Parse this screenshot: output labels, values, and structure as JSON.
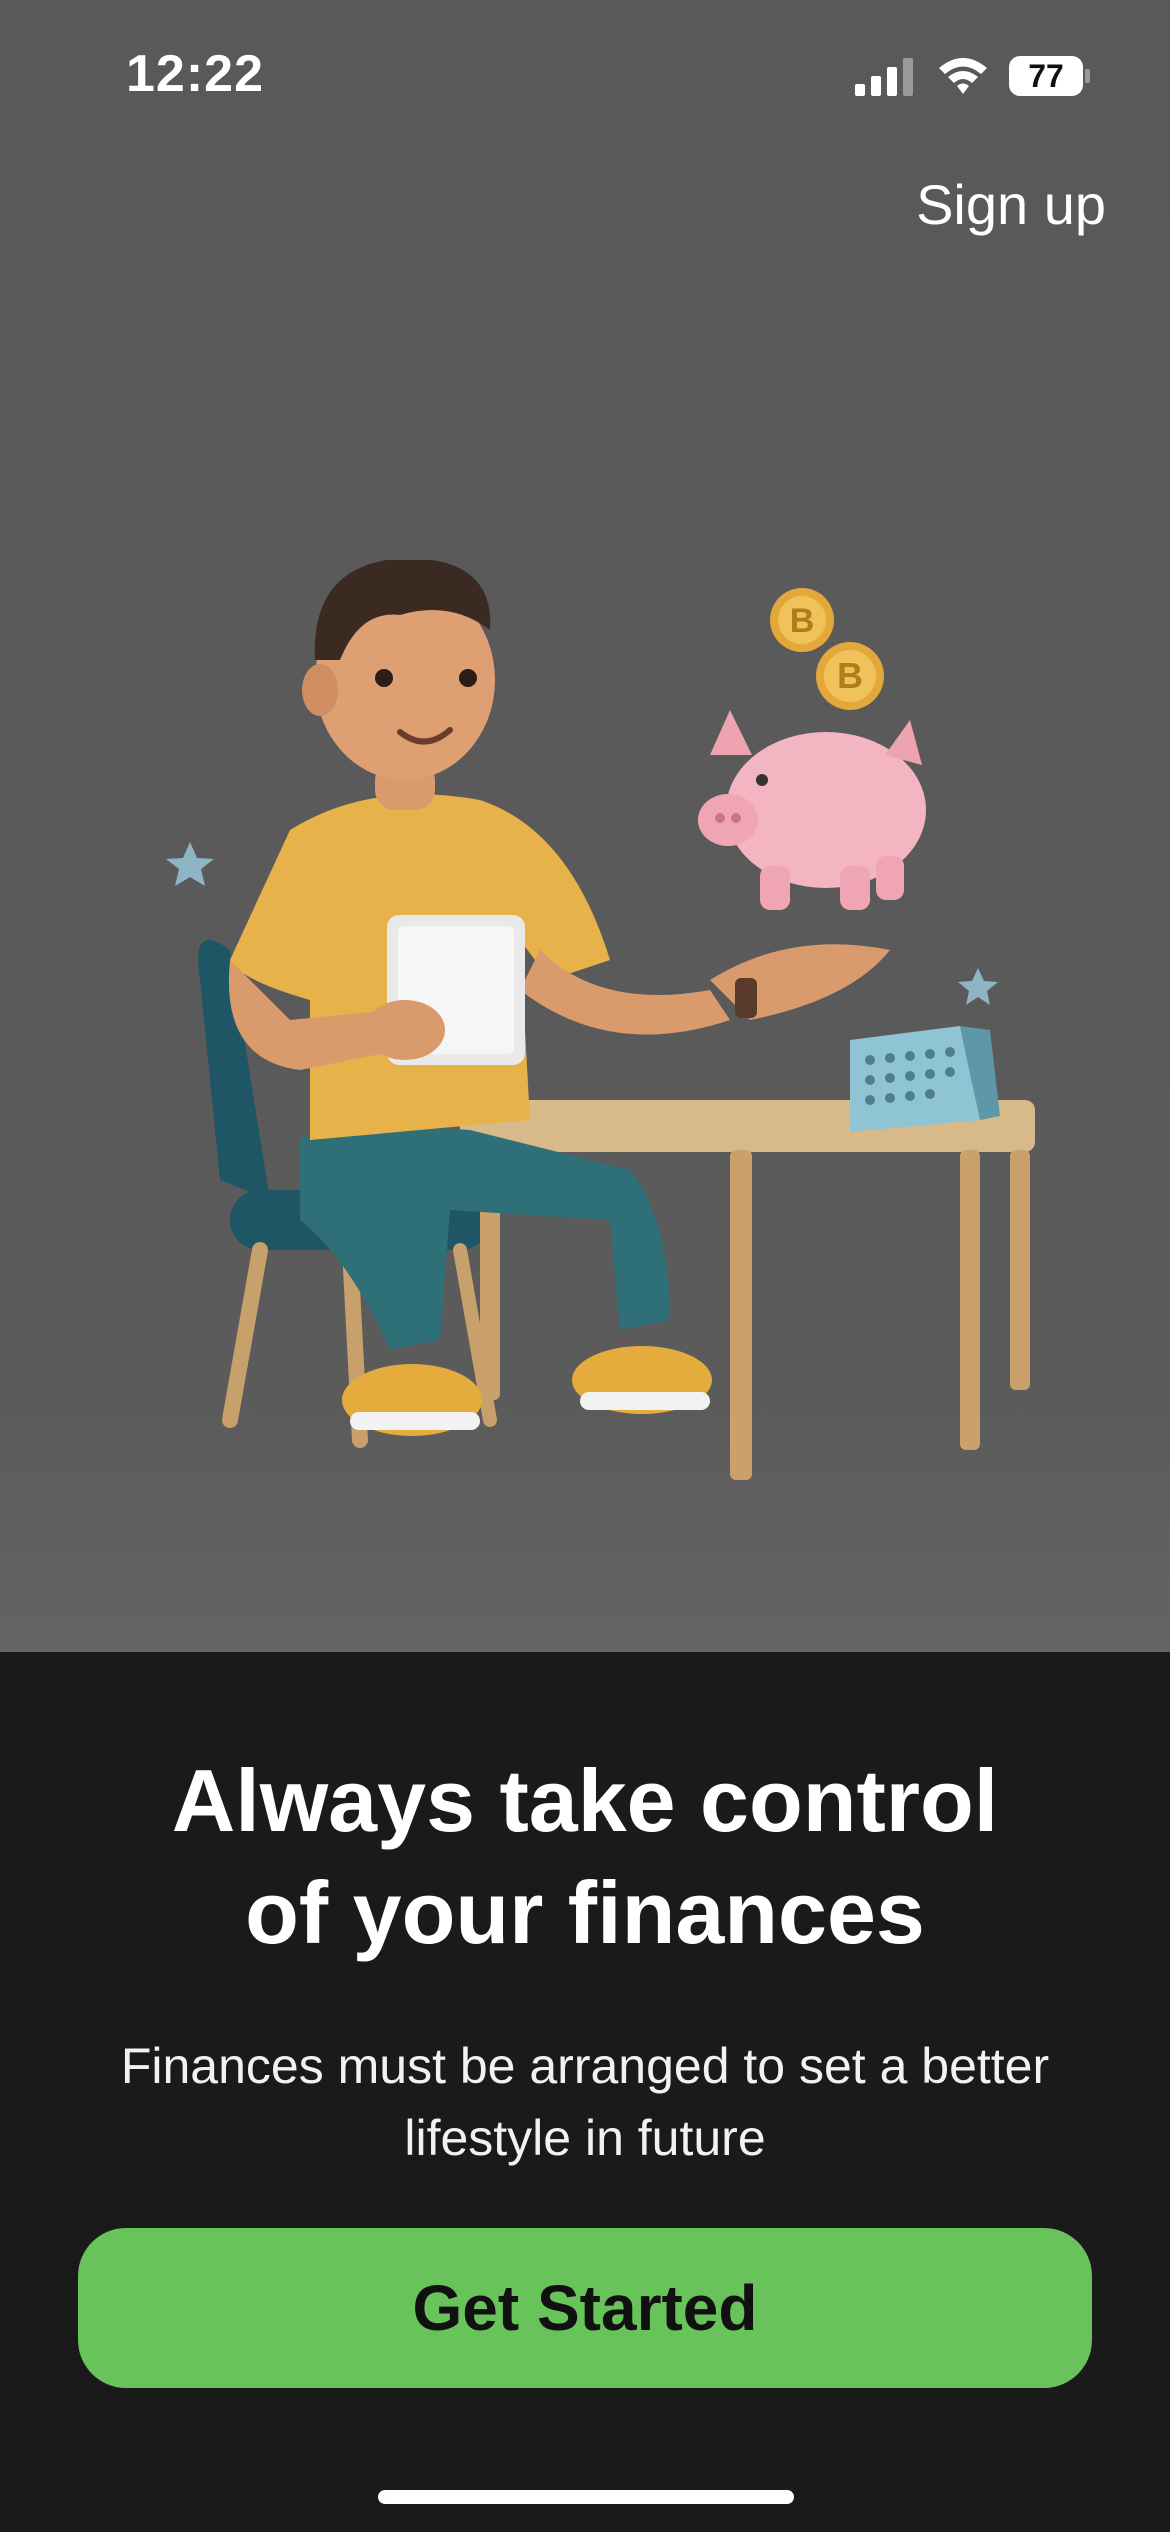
{
  "status_bar": {
    "time": "12:22",
    "battery": "77"
  },
  "header": {
    "signup_label": "Sign up"
  },
  "onboarding": {
    "headline_line1": "Always take control",
    "headline_line2": "of your finances",
    "subtitle_line1": "Finances must be arranged to set a better",
    "subtitle_line2": "lifestyle in future",
    "cta_label": "Get Started"
  },
  "colors": {
    "top_background": "#5a5a5a",
    "bottom_background": "#1a1a1a",
    "cta_background": "#67c35a",
    "text_primary": "#ffffff"
  },
  "icons": [
    "cellular-signal-icon",
    "wifi-icon",
    "battery-icon"
  ]
}
